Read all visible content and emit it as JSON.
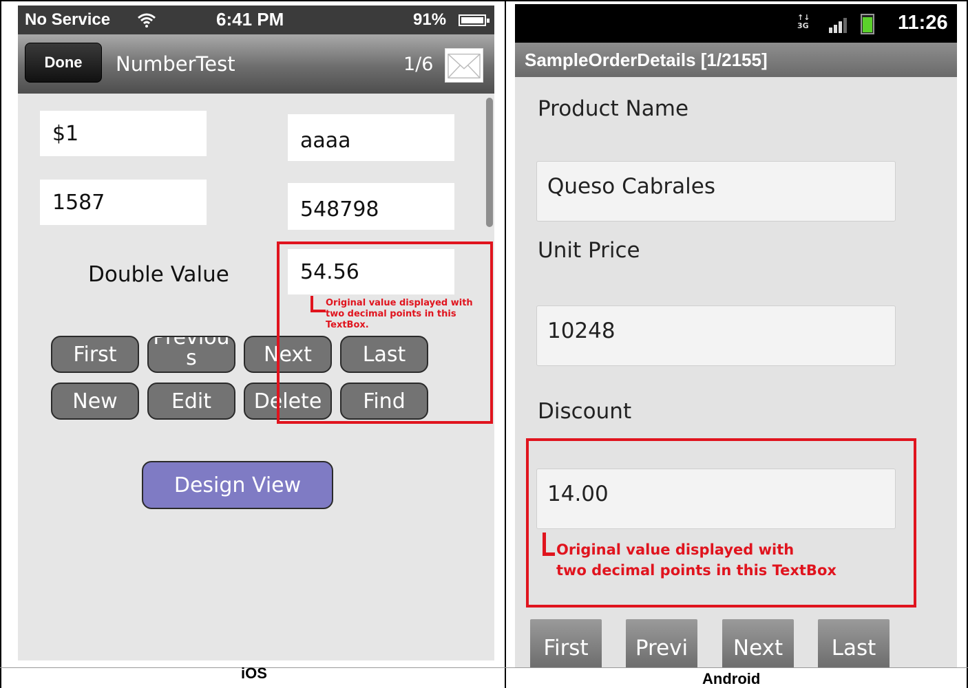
{
  "ios": {
    "status": {
      "carrier": "No Service",
      "time": "6:41 PM",
      "battery": "91%"
    },
    "nav": {
      "done_label": "Done",
      "title": "NumberTest",
      "page": "1/6"
    },
    "fields": {
      "f1": "$1",
      "f2": "aaaa",
      "f3": "1587",
      "f4": "548798",
      "double_label": "Double Value",
      "double_value": "54.56"
    },
    "callout": "Original value displayed with\ntwo decimal points in this\nTextBox.",
    "buttons": {
      "first": "First",
      "previous": "Previous",
      "next": "Next",
      "last": "Last",
      "new": "New",
      "edit": "Edit",
      "delete": "Delete",
      "find": "Find"
    },
    "design_view": "Design View",
    "caption": "iOS"
  },
  "android": {
    "status": {
      "network": "3G",
      "time": "11:26"
    },
    "title": "SampleOrderDetails [1/2155]",
    "product_name_label": "Product Name",
    "product_name_value": "Queso Cabrales",
    "unit_price_label": "Unit Price",
    "unit_price_value": "10248",
    "discount_label": "Discount",
    "discount_value": "14.00",
    "callout": "Original value displayed with\ntwo decimal points in this TextBox",
    "buttons": {
      "first": "First",
      "previous": "Previ",
      "next": "Next",
      "last": "Last"
    },
    "caption": "Android"
  },
  "colors": {
    "highlight": "#e0141e",
    "design_view_button": "#7f7bc4",
    "battery_green": "#5bd12b"
  }
}
